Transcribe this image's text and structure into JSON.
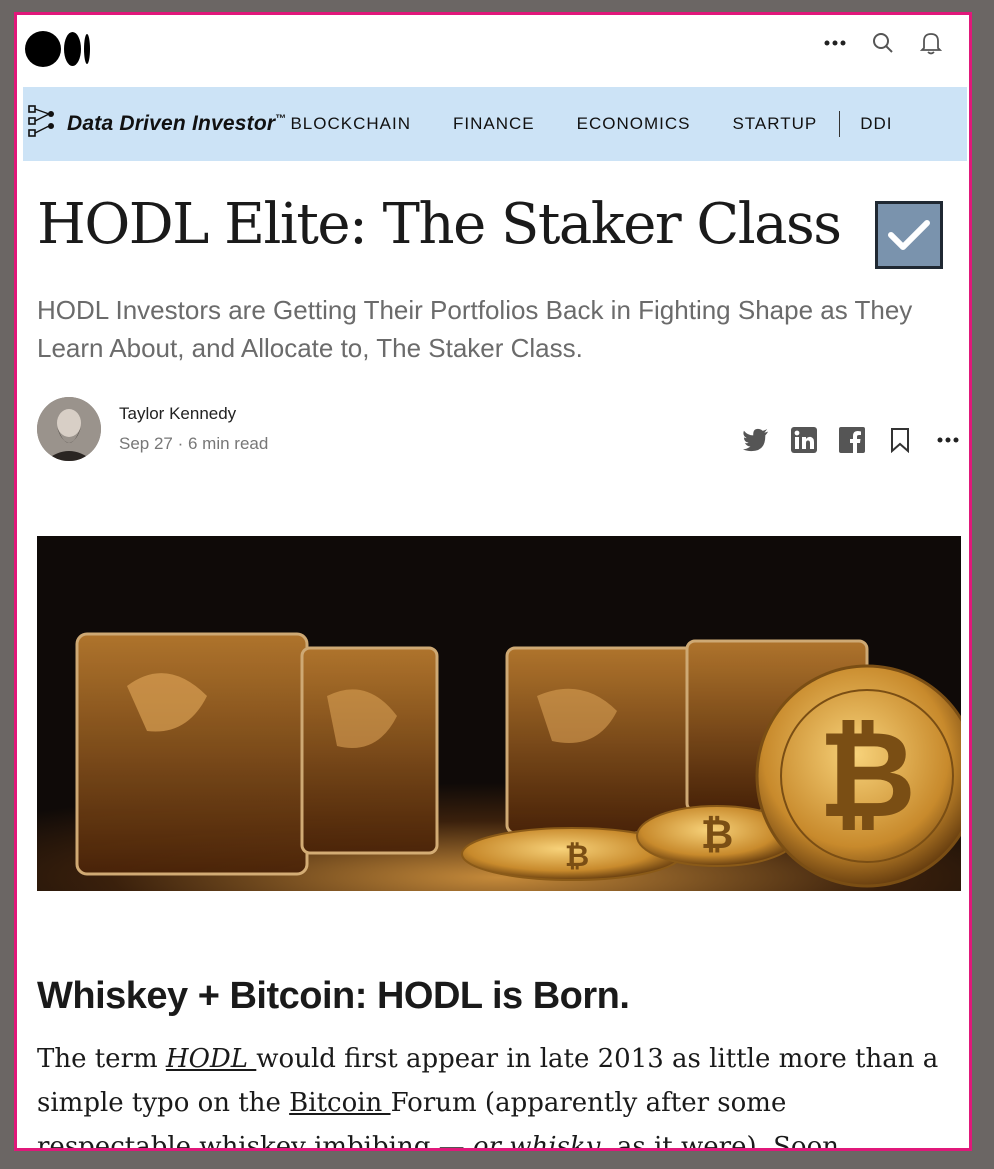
{
  "topbar": {
    "logo_icon": "medium-logo-icon",
    "icons": [
      "more-icon",
      "search-icon",
      "bell-icon"
    ]
  },
  "publication": {
    "name": "Data Driven Investor",
    "trademark": "™",
    "nav": [
      "BLOCKCHAIN",
      "FINANCE",
      "ECONOMICS",
      "STARTUP",
      "DDI"
    ]
  },
  "article": {
    "title": "HODL Elite: The Staker Class",
    "title_icon": "checkbox-icon",
    "subtitle": "HODL Investors are Getting Their Portfolios Back in Fighting Shape as They Learn About, and Allocate to, The Staker Class.",
    "author": "Taylor Kennedy",
    "date": "Sep 27",
    "read_time": "6 min read",
    "share_icons": [
      "twitter-icon",
      "linkedin-icon",
      "facebook-icon",
      "bookmark-icon",
      "more-icon"
    ],
    "heading": "Whiskey + Bitcoin: HODL is Born.",
    "p_start": "The term ",
    "p_hodl": "HODL ",
    "p_mid": "would first appear in late 2013 as little more than a simple typo on the ",
    "p_bitcoin": "Bitcoin ",
    "p_end": "Forum (apparently after some respectable whiskey imbibing — ",
    "p_whisky": "or whisky",
    "p_tail": ", as it were). Soon thereafter, and from"
  },
  "colors": {
    "frame": "#e0187a",
    "pubbar": "#cce3f6",
    "checkbox": "#7a93ad"
  }
}
